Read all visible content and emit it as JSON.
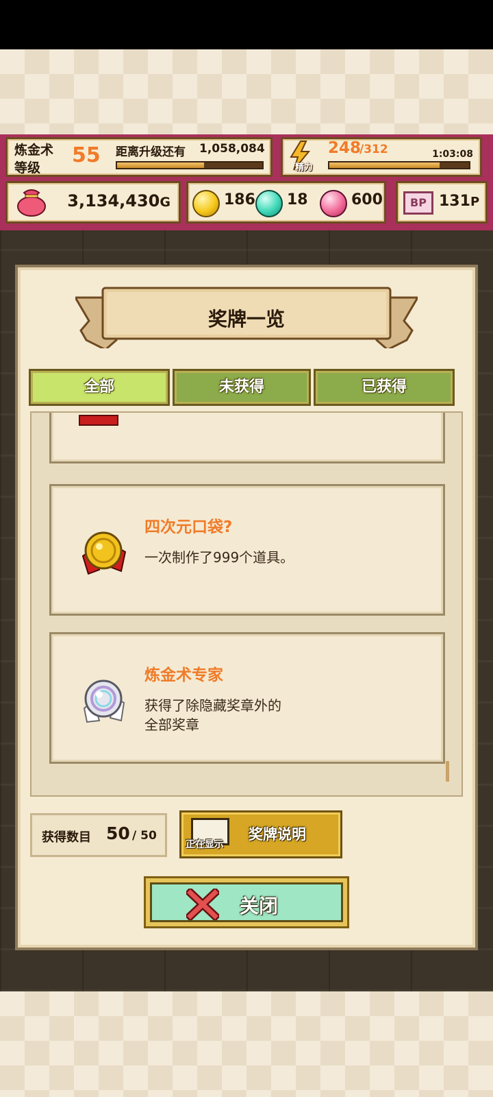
{
  "hud": {
    "level_label_1": "炼金术",
    "level_label_2": "等级",
    "level": "55",
    "next_level_label": "距离升级还有",
    "next_level_value": "1,058,084",
    "exp_progress": 0.6,
    "energy_label": "精力",
    "energy_current": "248",
    "energy_max": "/312",
    "energy_timer": "1:03:08",
    "energy_progress": 0.79,
    "gold": "3,134,430",
    "gold_unit": "G",
    "gem_yellow": "186",
    "gem_teal": "18",
    "gem_pink": "600",
    "bp_icon": "BP",
    "bp_value": "131",
    "bp_unit": "P"
  },
  "panel": {
    "title": "奖牌一览",
    "tabs": [
      {
        "label": "全部",
        "active": true
      },
      {
        "label": "未获得",
        "active": false
      },
      {
        "label": "已获得",
        "active": false
      }
    ],
    "medals": [
      {
        "title": "四次元口袋?",
        "desc": "一次制作了999个道具。",
        "icon": "gold-medal-icon"
      },
      {
        "title": "炼金术专家",
        "desc_1": "获得了除隐藏奖章外的",
        "desc_2": "全部奖章",
        "icon": "rainbow-medal-icon"
      }
    ],
    "count_label": "获得数目",
    "count_value": "50",
    "count_total": "/ 50",
    "explain_badge": "正在显示",
    "explain_label": "奖牌说明",
    "close_label": "关闭"
  },
  "colors": {
    "hud_bg": "#a8305a",
    "medal_title": "#f07b29",
    "tab_active": "#c9e46a",
    "tab_inactive": "#8cab4a",
    "close_btn": "#9fe6c4"
  }
}
